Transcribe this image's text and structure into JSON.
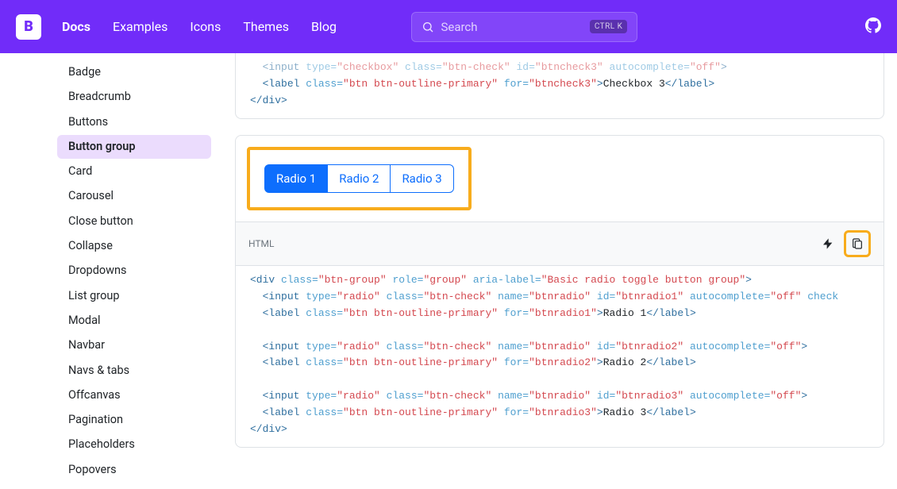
{
  "navbar": {
    "brand": "B",
    "items": [
      "Docs",
      "Examples",
      "Icons",
      "Themes",
      "Blog"
    ],
    "search_ph": "Search",
    "kbd": "CTRL K"
  },
  "sidebar": [
    "Badge",
    "Breadcrumb",
    "Buttons",
    "Button group",
    "Card",
    "Carousel",
    "Close button",
    "Collapse",
    "Dropdowns",
    "List group",
    "Modal",
    "Navbar",
    "Navs & tabs",
    "Offcanvas",
    "Pagination",
    "Placeholders",
    "Popovers"
  ],
  "sidebar_active": 3,
  "top_code": {
    "l1": {
      "a": "<input",
      "b": " type=",
      "c": "\"checkbox\"",
      "d": " class=",
      "e": "\"btn-check\"",
      "f": " id=",
      "g": "\"btncheck3\"",
      "h": " autocomplete=",
      "i": "\"off\"",
      "j": ">"
    },
    "l2": {
      "a": "<label",
      "b": " class=",
      "c": "\"btn btn-outline-primary\"",
      "d": " for=",
      "e": "\"btncheck3\"",
      "f": ">",
      "g": "Checkbox 3",
      "h": "</label>"
    },
    "l3": "</div>"
  },
  "radios": [
    "Radio 1",
    "Radio 2",
    "Radio 3"
  ],
  "code_header": "HTML",
  "main_code": {
    "open": {
      "a": "<div",
      "b": " class=",
      "c": "\"btn-group\"",
      "d": " role=",
      "e": "\"group\"",
      "f": " aria-label=",
      "g": "\"Basic radio toggle button group\"",
      "h": ">"
    },
    "r1i": {
      "a": "<input",
      "b": " type=",
      "c": "\"radio\"",
      "d": " class=",
      "e": "\"btn-check\"",
      "f": " name=",
      "g": "\"btnradio\"",
      "h": " id=",
      "i": "\"btnradio1\"",
      "j": " autocomplete=",
      "k": "\"off\"",
      "l": " check"
    },
    "r1l": {
      "a": "<label",
      "b": " class=",
      "c": "\"btn btn-outline-primary\"",
      "d": " for=",
      "e": "\"btnradio1\"",
      "f": ">",
      "g": "Radio 1",
      "h": "</label>"
    },
    "r2i": {
      "a": "<input",
      "b": " type=",
      "c": "\"radio\"",
      "d": " class=",
      "e": "\"btn-check\"",
      "f": " name=",
      "g": "\"btnradio\"",
      "h": " id=",
      "i": "\"btnradio2\"",
      "j": " autocomplete=",
      "k": "\"off\"",
      "l": ">"
    },
    "r2l": {
      "a": "<label",
      "b": " class=",
      "c": "\"btn btn-outline-primary\"",
      "d": " for=",
      "e": "\"btnradio2\"",
      "f": ">",
      "g": "Radio 2",
      "h": "</label>"
    },
    "r3i": {
      "a": "<input",
      "b": " type=",
      "c": "\"radio\"",
      "d": " class=",
      "e": "\"btn-check\"",
      "f": " name=",
      "g": "\"btnradio\"",
      "h": " id=",
      "i": "\"btnradio3\"",
      "j": " autocomplete=",
      "k": "\"off\"",
      "l": ">"
    },
    "r3l": {
      "a": "<label",
      "b": " class=",
      "c": "\"btn btn-outline-primary\"",
      "d": " for=",
      "e": "\"btnradio3\"",
      "f": ">",
      "g": "Radio 3",
      "h": "</label>"
    },
    "close": "</div>"
  }
}
